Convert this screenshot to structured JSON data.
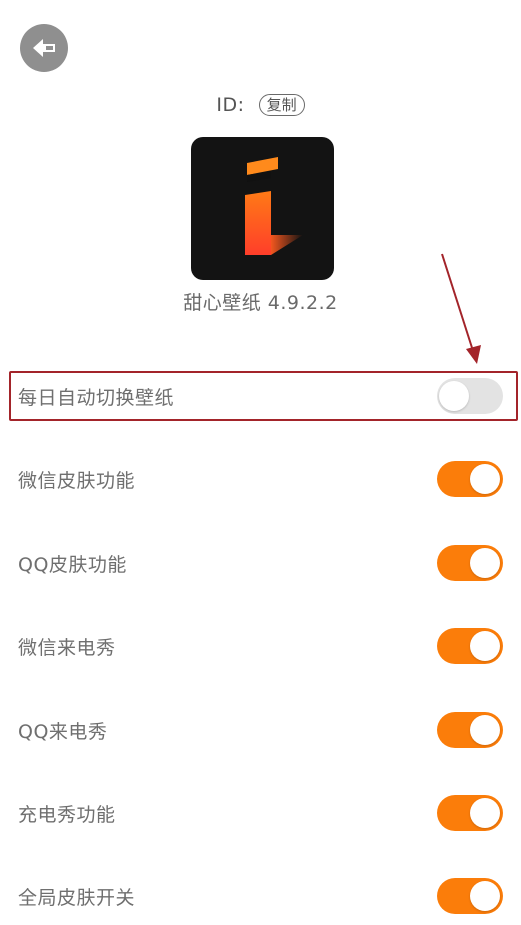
{
  "header": {
    "back_icon": "back-arrow-icon",
    "id_label": "ID:",
    "copy_label": "复制"
  },
  "app": {
    "logo_icon": "app-logo-icon",
    "version_text": "甜心壁纸 4.9.2.2"
  },
  "settings": [
    {
      "label": "每日自动切换壁纸",
      "enabled": false,
      "highlighted": true
    },
    {
      "label": "微信皮肤功能",
      "enabled": true
    },
    {
      "label": "QQ皮肤功能",
      "enabled": true
    },
    {
      "label": "微信来电秀",
      "enabled": true
    },
    {
      "label": "QQ来电秀",
      "enabled": true
    },
    {
      "label": "充电秀功能",
      "enabled": true
    },
    {
      "label": "全局皮肤开关",
      "enabled": true
    }
  ],
  "colors": {
    "toggle_on": "#fb7d0a",
    "toggle_off": "#e3e3e3",
    "annotation": "#a3242a"
  }
}
